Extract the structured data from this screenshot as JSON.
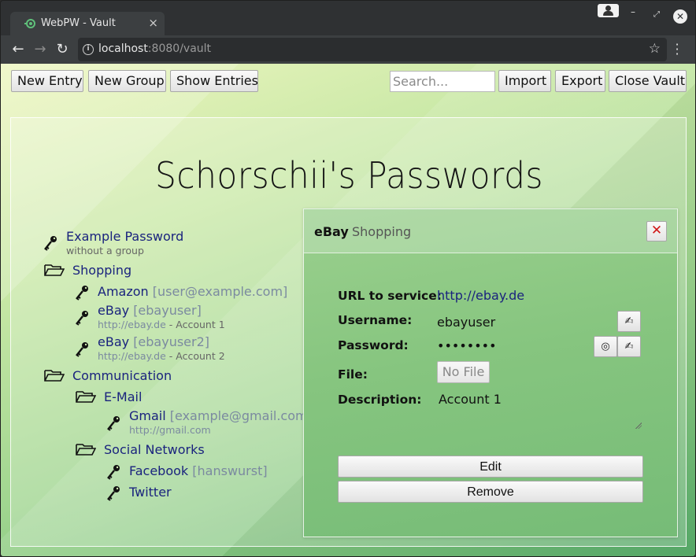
{
  "browser": {
    "tab_title": "WebPW - Vault",
    "url_host": "localhost",
    "url_rest": ":8080/vault"
  },
  "toolbar": {
    "new_entry": "New Entry",
    "new_group": "New Group",
    "show_entries": "Show Entries",
    "search_placeholder": "Search...",
    "import": "Import",
    "export": "Export",
    "close_vault": "Close Vault"
  },
  "vault": {
    "title": "Schorschii's Passwords"
  },
  "tree": {
    "example": {
      "name": "Example Password",
      "sub": "without a group"
    },
    "shopping": {
      "name": "Shopping"
    },
    "amazon": {
      "name": "Amazon",
      "user": "[user@example.com]"
    },
    "ebay1": {
      "name": "eBay",
      "user": "[ebayuser]",
      "url": "http://ebay.de",
      "desc": " - Account 1"
    },
    "ebay2": {
      "name": "eBay",
      "user": "[ebayuser2]",
      "url": "http://ebay.de",
      "desc": " - Account 2"
    },
    "communication": {
      "name": "Communication"
    },
    "email": {
      "name": "E-Mail"
    },
    "gmail": {
      "name": "Gmail",
      "user": "[example@gmail.com]",
      "url": "http://gmail.com"
    },
    "social": {
      "name": "Social Networks"
    },
    "facebook": {
      "name": "Facebook",
      "user": "[hanswurst]"
    },
    "twitter": {
      "name": "Twitter"
    }
  },
  "detail": {
    "entry_name": "eBay",
    "entry_group": "Shopping",
    "url_label": "URL to service:",
    "url_value": "http://ebay.de",
    "username_label": "Username:",
    "username_value": "ebayuser",
    "password_label": "Password:",
    "password_value": "••••••••",
    "file_label": "File:",
    "file_value": "No File",
    "description_label": "Description:",
    "description_value": "Account 1",
    "edit_button": "Edit",
    "remove_button": "Remove"
  }
}
